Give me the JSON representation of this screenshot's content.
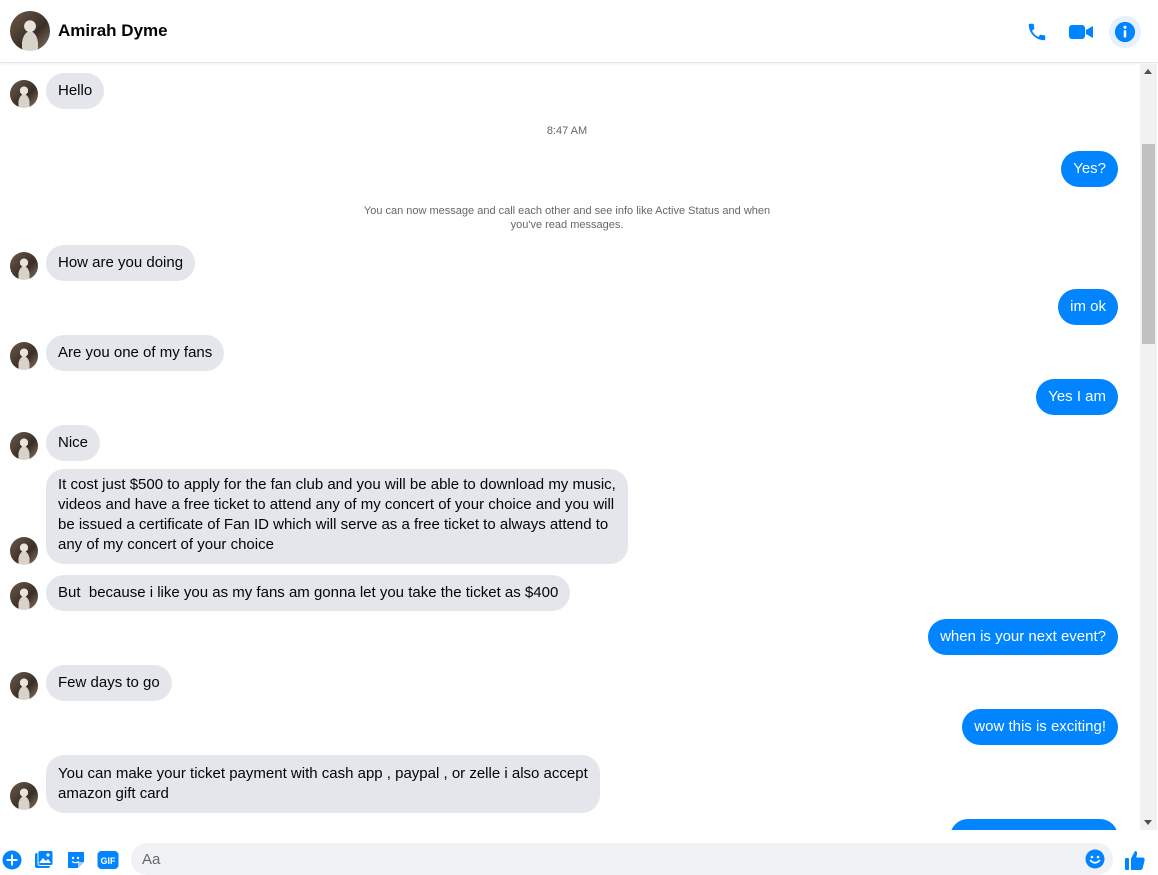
{
  "header": {
    "contact_name": "Amirah Dyme",
    "icons": {
      "call": "phone-icon",
      "video": "video-camera-icon",
      "info": "info-icon"
    }
  },
  "chat": {
    "timestamp": "8:47 AM",
    "system_note": "You can now message and call each other and see info like Active Status and when you've read messages.",
    "messages": [
      {
        "direction": "incoming",
        "text": "Hello"
      },
      {
        "direction": "outgoing",
        "text": "Yes?"
      },
      {
        "direction": "incoming",
        "text": "How are you doing"
      },
      {
        "direction": "outgoing",
        "text": "im ok"
      },
      {
        "direction": "incoming",
        "text": "Are you one of my fans"
      },
      {
        "direction": "outgoing",
        "text": "Yes I am"
      },
      {
        "direction": "incoming",
        "text": "Nice"
      },
      {
        "direction": "incoming",
        "text": "It cost just $500 to apply for the fan club and you will be able to download my music,\nvideos and have a free ticket to attend any of my concert of your choice and you will\nbe issued a certificate of Fan ID which will serve as a free ticket to always attend to\nany of my concert of your choice"
      },
      {
        "direction": "incoming",
        "text": "But  because i like you as my fans am gonna let you take the ticket as $400"
      },
      {
        "direction": "outgoing",
        "text": "when is your next event?"
      },
      {
        "direction": "incoming",
        "text": "Few days to go"
      },
      {
        "direction": "outgoing",
        "text": "wow this is exciting!"
      },
      {
        "direction": "incoming",
        "text": "You can make your ticket payment with cash app , paypal , or zelle i also accept\namazon gift card"
      }
    ]
  },
  "composer": {
    "placeholder": "Aa",
    "icons": [
      "plus-icon",
      "photo-icon",
      "sticker-icon",
      "gif-icon",
      "emoji-icon",
      "thumbs-up-icon"
    ],
    "gif_label": "GIF"
  },
  "colors": {
    "accent": "#0084ff",
    "incoming_bubble": "#e4e6eb",
    "icon_blue": "#0084ff"
  }
}
